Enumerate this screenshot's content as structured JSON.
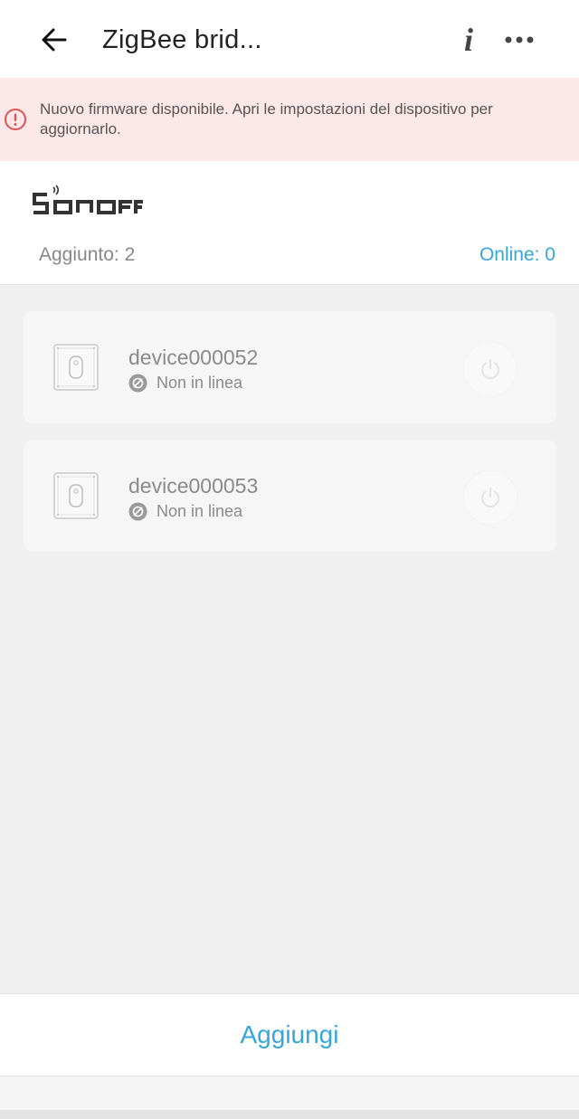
{
  "header": {
    "title": "ZigBee brid...",
    "info_glyph": "i",
    "icons": {
      "back": "back-arrow-icon",
      "info": "info-icon",
      "more": "more-dots-icon"
    }
  },
  "banner": {
    "text": "Nuovo firmware disponibile. Apri le impostazioni del dispositivo per aggiornarlo.",
    "icon": "alert-circle-icon",
    "color": "#e05252"
  },
  "summary": {
    "logo": "SONOFF",
    "added_label": "Aggiunto: 2",
    "online_label": "Online: 0"
  },
  "devices": [
    {
      "name": "device000052",
      "status": "Non in linea",
      "icon": "wall-switch-icon"
    },
    {
      "name": "device000053",
      "status": "Non in linea",
      "icon": "wall-switch-icon"
    }
  ],
  "footer": {
    "add_label": "Aggiungi"
  },
  "colors": {
    "accent": "#35a6dc",
    "banner_bg": "#fce8e8",
    "page_bg": "#f0f0f0"
  }
}
